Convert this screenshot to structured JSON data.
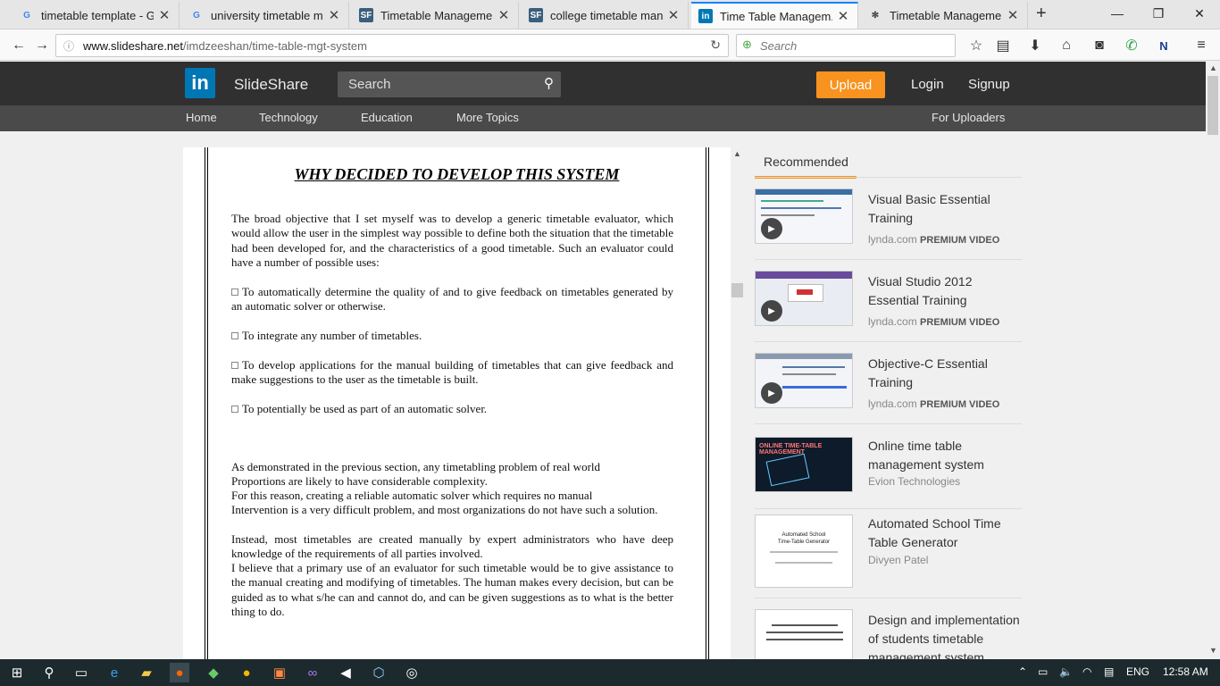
{
  "browser": {
    "tabs": [
      {
        "title": "timetable template - G...",
        "favicon": "G"
      },
      {
        "title": "university timetable m...",
        "favicon": "G"
      },
      {
        "title": "Timetable Manageme...",
        "favicon": "SF"
      },
      {
        "title": "college timetable man...",
        "favicon": "SF"
      },
      {
        "title": "Time Table Managem...",
        "favicon": "in"
      },
      {
        "title": "Timetable Manageme...",
        "favicon": "🐞"
      }
    ],
    "url_domain": "www.slideshare.net",
    "url_path": "/imdzeeshan/time-table-mgt-system",
    "search_placeholder": "Search"
  },
  "slideshare": {
    "brand": "SlideShare",
    "search_placeholder": "Search",
    "upload_label": "Upload",
    "login_label": "Login",
    "signup_label": "Signup",
    "nav": [
      "Home",
      "Technology",
      "Education",
      "More Topics"
    ],
    "for_uploaders": "For Uploaders",
    "accent_color": "#f7931e"
  },
  "document": {
    "title": "WHY DECIDED TO DEVELOP THIS SYSTEM",
    "intro": "The broad objective that I set myself was to develop a generic timetable evaluator, which would allow the user in the simplest way possible to define both the situation that the timetable had been developed for, and the characteristics of a good timetable. Such an evaluator could have a number of possible uses:",
    "bullets": [
      "To automatically determine the quality of and to give feedback on timetables generated by an automatic solver or otherwise.",
      "To integrate any number of timetables.",
      "To develop applications for the manual building of timetables that can give feedback and make suggestions to the user as the timetable is built.",
      "To potentially be used as part of an automatic solver."
    ],
    "closing": [
      "As demonstrated in the previous section, any timetabling problem of real world",
      "Proportions are likely to have considerable complexity.",
      "For this reason, creating a reliable automatic solver which requires no manual",
      "Intervention is a very difficult problem, and most organizations do not have such a solution.",
      "Instead, most timetables are created manually by expert administrators who have deep knowledge of the requirements of all parties involved.",
      "I believe that a primary use of an evaluator for such timetable would be to give assistance to the manual creating and modifying of timetables. The human makes every decision, but can be guided as to what s/he can and cannot do, and can be given suggestions as to what is the better thing to do."
    ]
  },
  "recommended": {
    "tab_label": "Recommended",
    "items": [
      {
        "title": "Visual Basic Essential Training",
        "source": "lynda.com",
        "badge": "PREMIUM VIDEO"
      },
      {
        "title": "Visual Studio 2012 Essential Training",
        "source": "lynda.com",
        "badge": "PREMIUM VIDEO"
      },
      {
        "title": "Objective-C Essential Training",
        "source": "lynda.com",
        "badge": "PREMIUM VIDEO"
      },
      {
        "title": "Online time table management system",
        "source": "Evion Technologies",
        "badge": ""
      },
      {
        "title": "Automated School Time Table Generator",
        "source": "Divyen Patel",
        "badge": ""
      },
      {
        "title": "Design and implementation of students timetable management system",
        "source": "",
        "badge": ""
      }
    ],
    "thumb5_lines": [
      "Automated School",
      "Time-Table Generator"
    ]
  },
  "taskbar": {
    "language": "ENG",
    "time": "12:58 AM"
  }
}
